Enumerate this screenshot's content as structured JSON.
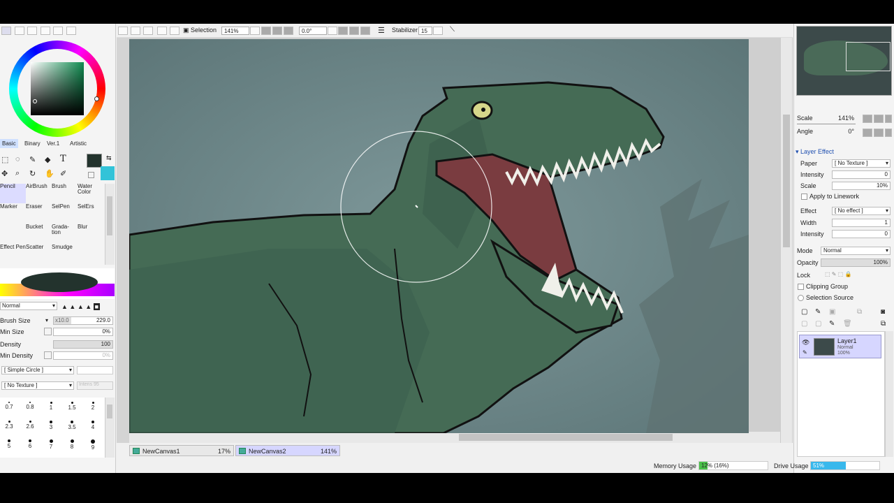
{
  "colors": {
    "fg": "#23332d",
    "bg": "#33c3d8",
    "accent": "#d6d6ff"
  },
  "left": {
    "tabs": [
      "Basic",
      "Binary",
      "Ver.1",
      "Artistic"
    ],
    "tools": [
      {
        "label": "Pencil",
        "sel": true
      },
      {
        "label": "AirBrush"
      },
      {
        "label": "Brush"
      },
      {
        "label": "Water Color"
      },
      {
        "label": "Marker"
      },
      {
        "label": "Eraser"
      },
      {
        "label": "SelPen"
      },
      {
        "label": "SelErs"
      },
      {
        "label": ""
      },
      {
        "label": "Bucket"
      },
      {
        "label": "Grada-tion"
      },
      {
        "label": "Blur"
      },
      {
        "label": "Effect Pen"
      },
      {
        "label": "Scatter"
      },
      {
        "label": "Smudge"
      },
      {
        "label": ""
      }
    ],
    "blend_mode": "Normal",
    "brush_size_label": "Brush Size",
    "brush_size_mult": "x10.0",
    "brush_size": "229.0",
    "min_size_label": "Min Size",
    "min_size": "0%",
    "density_label": "Density",
    "density": "100",
    "min_density_label": "Min Density",
    "min_density": "0%",
    "shape": "[ Simple Circle ]",
    "texture": "[ No Texture ]",
    "texture_int": "Intens 95",
    "dot_sizes": [
      "0.7",
      "0.8",
      "1",
      "1.5",
      "2",
      "2.3",
      "2.6",
      "3",
      "3.5",
      "4",
      "5",
      "6",
      "7",
      "8",
      "9"
    ]
  },
  "toolbar": {
    "selection": "Selection",
    "zoom": "141%",
    "angle": "0.0°",
    "stabilizer_label": "Stabilizer",
    "stabilizer": "15"
  },
  "tabs": [
    {
      "name": "NewCanvas1",
      "zoom": "17%"
    },
    {
      "name": "NewCanvas2",
      "zoom": "141%"
    }
  ],
  "right": {
    "scale_label": "Scale",
    "scale": "141%",
    "angle_label": "Angle",
    "angle": "0°",
    "layer_effect": "Layer Effect",
    "paper_label": "Paper",
    "paper": "[ No Texture ]",
    "intensity_label": "Intensity",
    "intensity": "0",
    "scale2_label": "Scale",
    "scale2": "10%",
    "apply_lineworks": "Apply to Linework",
    "effect_label": "Effect",
    "effect": "[ No effect ]",
    "width_label": "Width",
    "width": "1",
    "intensity2_label": "Intensity",
    "intensity2": "0",
    "mode_label": "Mode",
    "mode": "Normal",
    "opacity_label": "Opacity",
    "opacity": "100%",
    "lock_label": "Lock",
    "clipping": "Clipping Group",
    "selsource": "Selection Source",
    "layer": {
      "name": "Layer1",
      "mode": "Normal",
      "opacity": "100%"
    }
  },
  "status": {
    "memory_label": "Memory Usage",
    "memory": "12% (16%)",
    "memory_pct": 0.12,
    "drive_label": "Drive Usage",
    "drive": "51%",
    "drive_pct": 0.51
  }
}
